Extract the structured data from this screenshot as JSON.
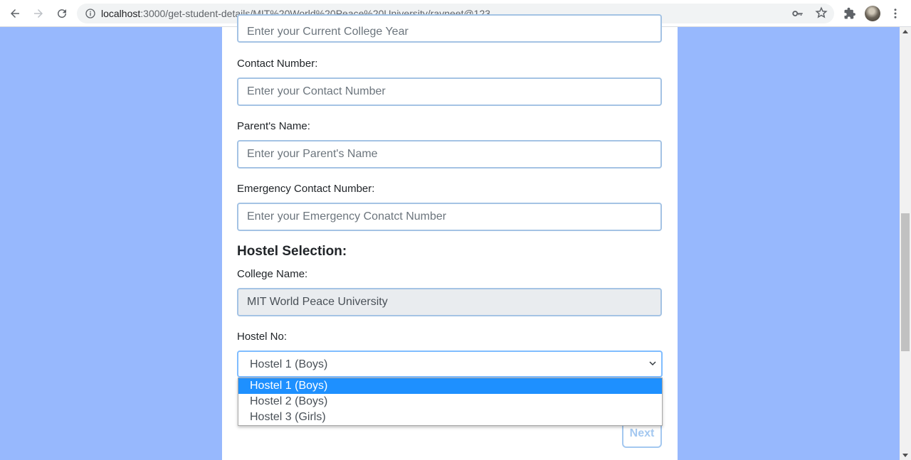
{
  "browser": {
    "url_host": "localhost",
    "url_rest": ":3000/get-student-details/MIT%20World%20Peace%20University/ravneet@123"
  },
  "form": {
    "college_year_placeholder": "Enter your Current College Year",
    "contact_label": "Contact Number:",
    "contact_placeholder": "Enter your Contact Number",
    "parent_label": "Parent's Name:",
    "parent_placeholder": "Enter your Parent's Name",
    "emergency_label": "Emergency Contact Number:",
    "emergency_placeholder": "Enter your Emergency Conatct Number",
    "hostel_section_title": "Hostel Selection:",
    "college_name_label": "College Name:",
    "college_name_value": "MIT World Peace University",
    "hostel_no_label": "Hostel No:",
    "hostel_selected": "Hostel 1 (Boys)",
    "hostel_options": [
      "Hostel 1 (Boys)",
      "Hostel 2 (Boys)",
      "Hostel 3 (Girls)"
    ],
    "next_label": "Next"
  },
  "colors": {
    "page_background": "#97b8fd",
    "input_border": "#a4c3e4",
    "option_highlight": "#1e90ff"
  }
}
